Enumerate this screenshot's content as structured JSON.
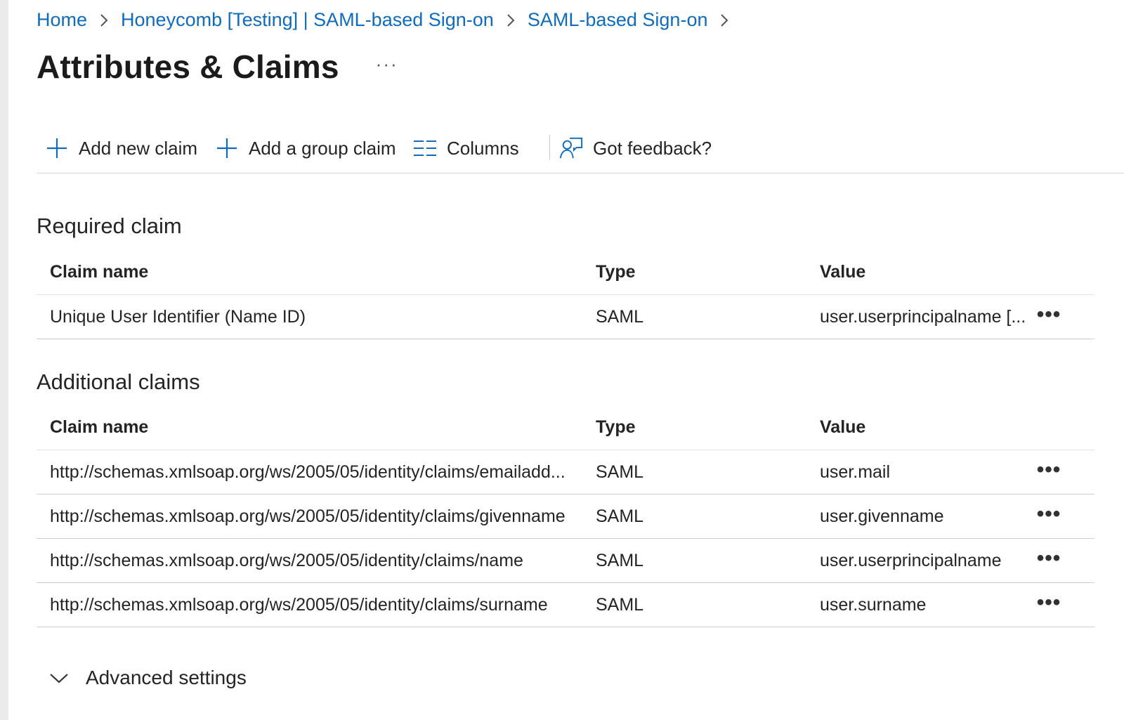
{
  "breadcrumb": {
    "items": [
      {
        "label": "Home"
      },
      {
        "label": "Honeycomb [Testing] | SAML-based Sign-on"
      },
      {
        "label": "SAML-based Sign-on"
      }
    ]
  },
  "page": {
    "title": "Attributes & Claims",
    "more_label": "···"
  },
  "toolbar": {
    "add_new_claim": "Add new claim",
    "add_group_claim": "Add a group claim",
    "columns": "Columns",
    "feedback": "Got feedback?"
  },
  "required": {
    "title": "Required claim",
    "headers": {
      "name": "Claim name",
      "type": "Type",
      "value": "Value"
    },
    "rows": [
      {
        "name": "Unique User Identifier (Name ID)",
        "type": "SAML",
        "value": "user.userprincipalname [...",
        "more": "•••"
      }
    ]
  },
  "additional": {
    "title": "Additional claims",
    "headers": {
      "name": "Claim name",
      "type": "Type",
      "value": "Value"
    },
    "rows": [
      {
        "name": "http://schemas.xmlsoap.org/ws/2005/05/identity/claims/emailadd...",
        "type": "SAML",
        "value": "user.mail",
        "more": "•••"
      },
      {
        "name": "http://schemas.xmlsoap.org/ws/2005/05/identity/claims/givenname",
        "type": "SAML",
        "value": "user.givenname",
        "more": "•••"
      },
      {
        "name": "http://schemas.xmlsoap.org/ws/2005/05/identity/claims/name",
        "type": "SAML",
        "value": "user.userprincipalname",
        "more": "•••"
      },
      {
        "name": "http://schemas.xmlsoap.org/ws/2005/05/identity/claims/surname",
        "type": "SAML",
        "value": "user.surname",
        "more": "•••"
      }
    ]
  },
  "advanced": {
    "label": "Advanced settings"
  },
  "colors": {
    "link": "#0f6cbd",
    "accent_icon": "#0f6cbd",
    "text": "#242424"
  },
  "icons": {
    "breadcrumb_separator": "chevron-right-icon",
    "add": "plus-icon",
    "columns": "columns-icon",
    "feedback": "feedback-icon",
    "advanced": "chevron-down-icon"
  }
}
